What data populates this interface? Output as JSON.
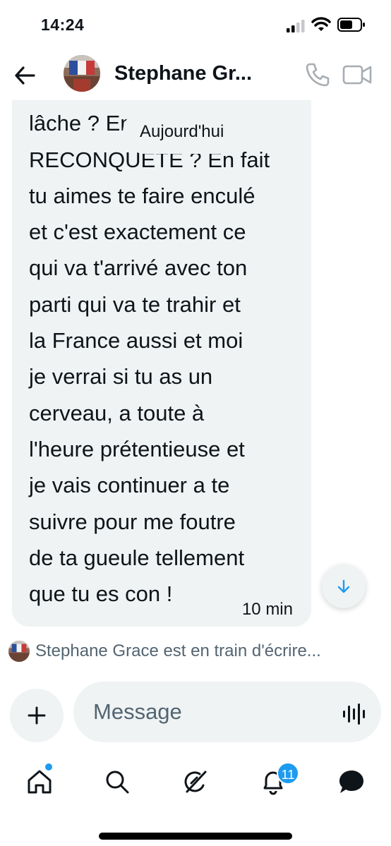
{
  "status_bar": {
    "time": "14:24"
  },
  "header": {
    "contact_name": "Stephane Gr...",
    "back_icon": "arrow-left-icon",
    "call_icon": "phone-icon",
    "video_icon": "video-camera-icon"
  },
  "chat": {
    "date_separator": "Aujourd'hui",
    "message": {
      "text": "pourquoi elle les\nlâche ? En fait\nRECONQUETE ? En fait\ntu aimes te faire enculé\net c'est exactement ce\nqui va t'arrivé avec ton\nparti qui va te  trahir et\nla France aussi et moi\nje verrai si tu as un\ncerveau, a toute à\nl'heure prétentieuse et\nje vais continuer a te\nsuivre pour me foutre\nde ta gueule tellement\nque tu es con !",
      "time": "10 min"
    },
    "scroll_icon": "arrow-down-icon"
  },
  "typing_indicator": "Stephane Grace est en train d'écrire...",
  "composer": {
    "placeholder": "Message",
    "add_icon": "plus-icon",
    "voice_icon": "waveform-icon"
  },
  "tab_bar": {
    "tabs": [
      "home-icon",
      "search-icon",
      "grok-icon",
      "bell-icon",
      "messages-icon"
    ],
    "notification_count": "11"
  },
  "colors": {
    "accent": "#1d9bf0",
    "bubble": "#eff3f4",
    "secondary_text": "#536471"
  }
}
